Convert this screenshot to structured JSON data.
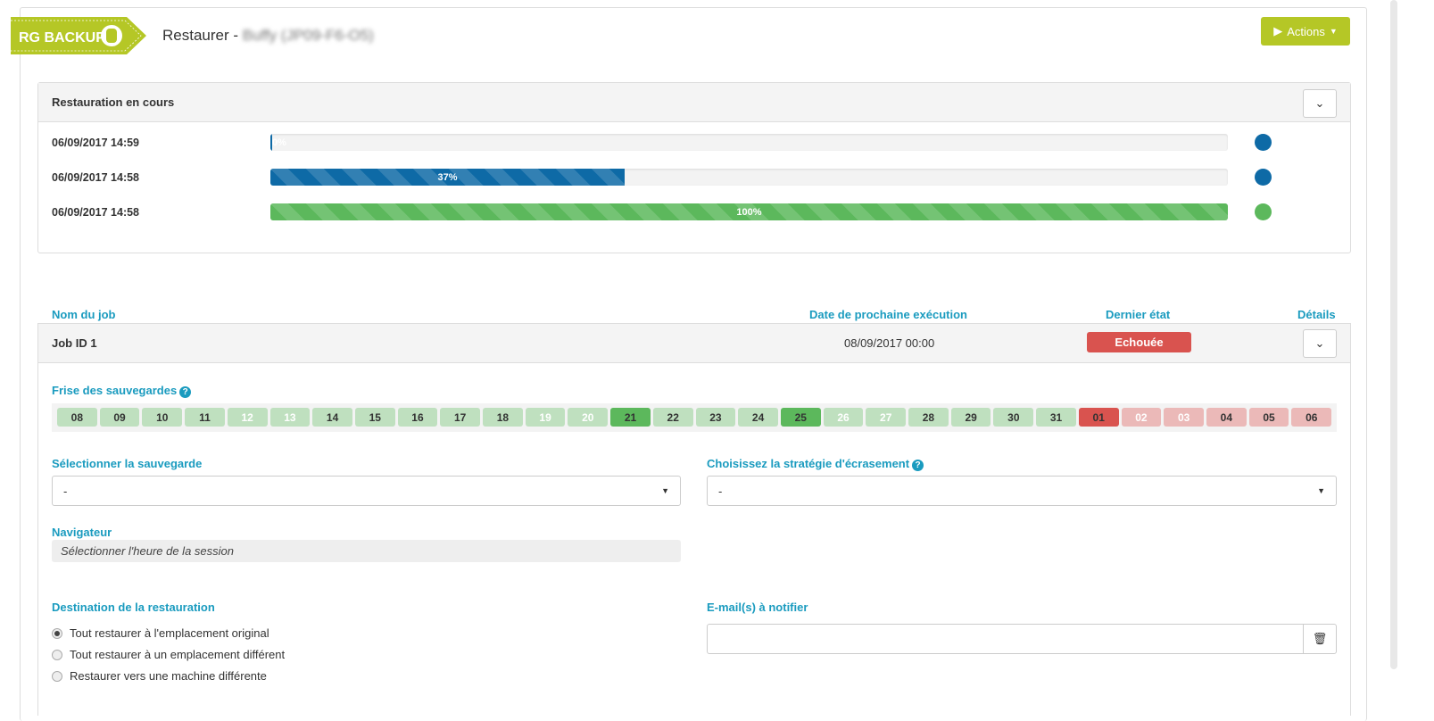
{
  "header": {
    "logo_text": "RG BACKUP",
    "title_prefix": "Restaurer - ",
    "title_host": "Buffy (JP09-F6-O5)",
    "actions_label": "Actions"
  },
  "restore_panel": {
    "title": "Restauration en cours",
    "rows": [
      {
        "date": "06/09/2017 14:59",
        "progress": 0,
        "label": "0%",
        "color": "#0e6aa6"
      },
      {
        "date": "06/09/2017 14:58",
        "progress": 37,
        "label": "37%",
        "color": "#0e6aa6"
      },
      {
        "date": "06/09/2017 14:58",
        "progress": 100,
        "label": "100%",
        "color": "#5cb85c"
      }
    ]
  },
  "job_table": {
    "col_name": "Nom du job",
    "col_next": "Date de prochaine exécution",
    "col_state": "Dernier état",
    "col_details": "Détails",
    "job": {
      "name": "Job ID 1",
      "next": "08/09/2017 00:00",
      "state": "Echouée"
    }
  },
  "frise": {
    "label": "Frise des sauvegardes",
    "days": [
      {
        "d": "08",
        "s": "ok"
      },
      {
        "d": "09",
        "s": "ok"
      },
      {
        "d": "10",
        "s": "ok"
      },
      {
        "d": "11",
        "s": "ok"
      },
      {
        "d": "12",
        "s": "okw"
      },
      {
        "d": "13",
        "s": "okw"
      },
      {
        "d": "14",
        "s": "ok"
      },
      {
        "d": "15",
        "s": "ok"
      },
      {
        "d": "16",
        "s": "ok"
      },
      {
        "d": "17",
        "s": "ok"
      },
      {
        "d": "18",
        "s": "ok"
      },
      {
        "d": "19",
        "s": "okw"
      },
      {
        "d": "20",
        "s": "okw"
      },
      {
        "d": "21",
        "s": "good"
      },
      {
        "d": "22",
        "s": "ok"
      },
      {
        "d": "23",
        "s": "ok"
      },
      {
        "d": "24",
        "s": "ok"
      },
      {
        "d": "25",
        "s": "good"
      },
      {
        "d": "26",
        "s": "okw"
      },
      {
        "d": "27",
        "s": "okw"
      },
      {
        "d": "28",
        "s": "ok"
      },
      {
        "d": "29",
        "s": "ok"
      },
      {
        "d": "30",
        "s": "ok"
      },
      {
        "d": "31",
        "s": "ok"
      },
      {
        "d": "01",
        "s": "fail"
      },
      {
        "d": "02",
        "s": "failw"
      },
      {
        "d": "03",
        "s": "failw"
      },
      {
        "d": "04",
        "s": "faild"
      },
      {
        "d": "05",
        "s": "faild"
      },
      {
        "d": "06",
        "s": "faild"
      }
    ]
  },
  "form": {
    "backup_label": "Sélectionner la sauvegarde",
    "backup_value": "-",
    "strategy_label": "Choisissez la stratégie d'écrasement",
    "strategy_value": "-",
    "browser_label": "Navigateur",
    "browser_placeholder": "Sélectionner l'heure de la session",
    "dest_label": "Destination de la restauration",
    "dest_options": [
      "Tout restaurer à l'emplacement original",
      "Tout restaurer à un emplacement différent",
      "Restaurer vers une machine différente"
    ],
    "dest_selected": 0,
    "email_label": "E-mail(s) à notifier",
    "email_value": ""
  }
}
